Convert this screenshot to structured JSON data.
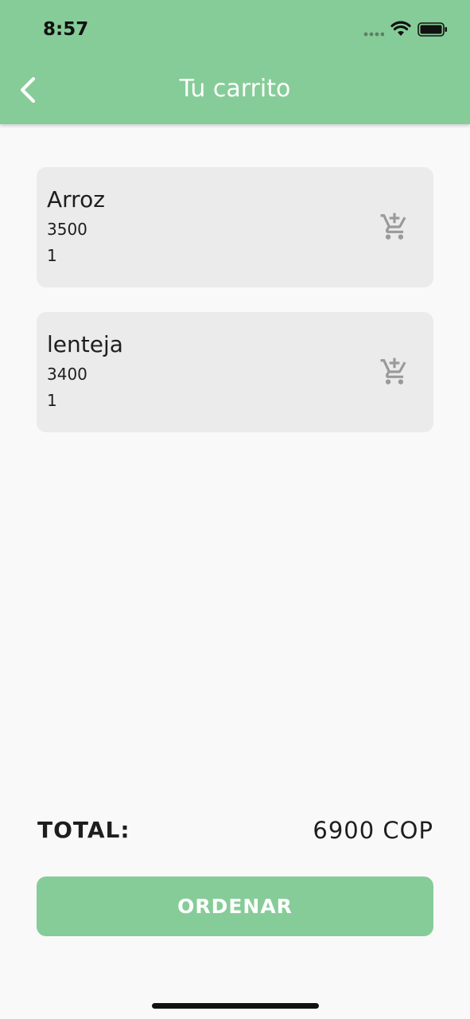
{
  "status_bar": {
    "time": "8:57"
  },
  "app_bar": {
    "title": "Tu carrito"
  },
  "cart": {
    "items": [
      {
        "name": "Arroz",
        "price": "3500",
        "quantity": "1"
      },
      {
        "name": "lenteja",
        "price": "3400",
        "quantity": "1"
      }
    ]
  },
  "summary": {
    "total_label": "TOTAL:",
    "total_value": "6900 COP"
  },
  "order_button": {
    "label": "ORDENAR"
  },
  "icons": {
    "back": "chevron-left-icon",
    "add_to_cart": "add-shopping-cart-icon",
    "signal": "signal-dots-icon",
    "wifi": "wifi-icon",
    "battery": "battery-icon"
  },
  "colors": {
    "accent": "#86cc98",
    "card": "#ebebeb",
    "background": "#f9f9f9"
  }
}
